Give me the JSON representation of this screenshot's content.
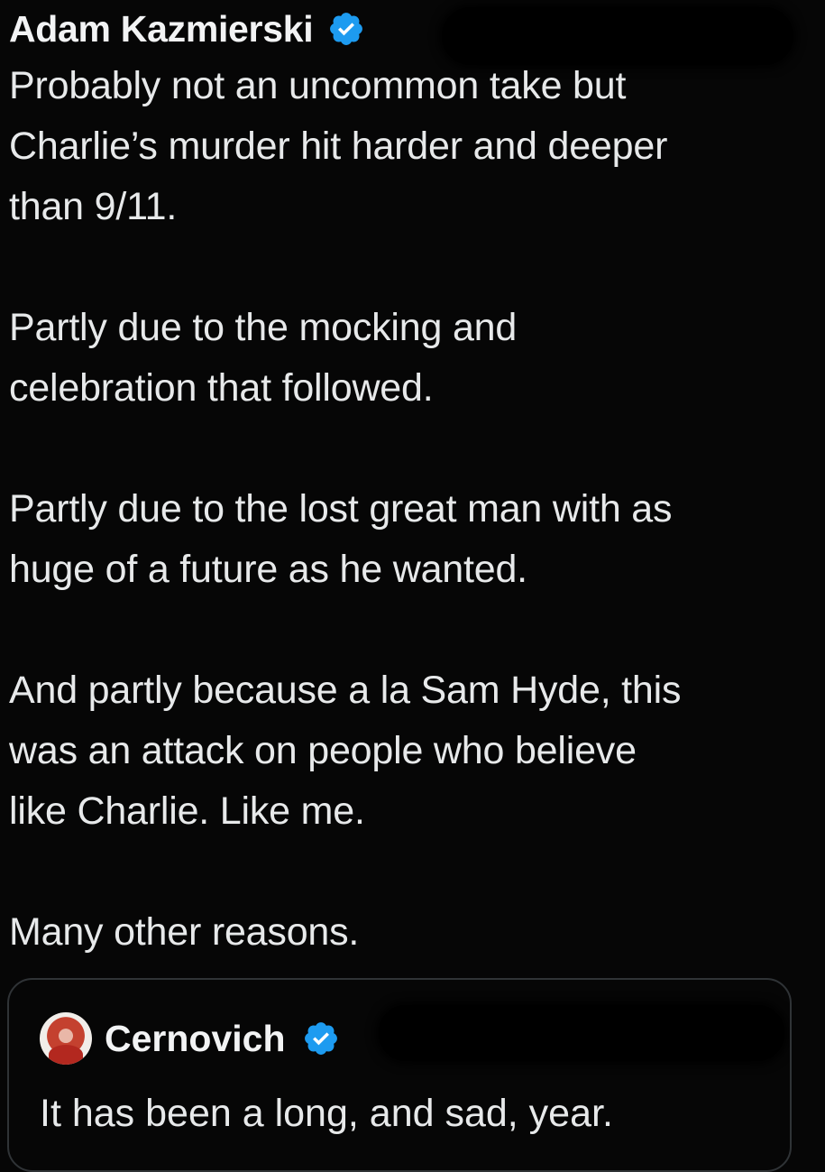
{
  "tweet": {
    "author": "Adam Kazmierski",
    "verified_icon": "verified-badge",
    "paragraphs": [
      [
        "Probably not an uncommon take but",
        "Charlie’s murder hit harder and deeper",
        "than 9/11."
      ],
      [
        "Partly due to the mocking and",
        "celebration that followed."
      ],
      [
        "Partly due to the lost great man with as",
        "huge of a future as he wanted."
      ],
      [
        "And partly because a la Sam Hyde, this",
        "was an attack on people who believe",
        "like Charlie. Like me."
      ],
      [
        "Many other reasons."
      ]
    ]
  },
  "quoted_tweet": {
    "author": "Cernovich",
    "verified_icon": "verified-badge",
    "text": "It has been a long, and sad, year."
  },
  "colors": {
    "background": "#060606",
    "text": "#e7e9ea",
    "verified_blue": "#1d9bf0",
    "quote_border": "#2f3336"
  }
}
